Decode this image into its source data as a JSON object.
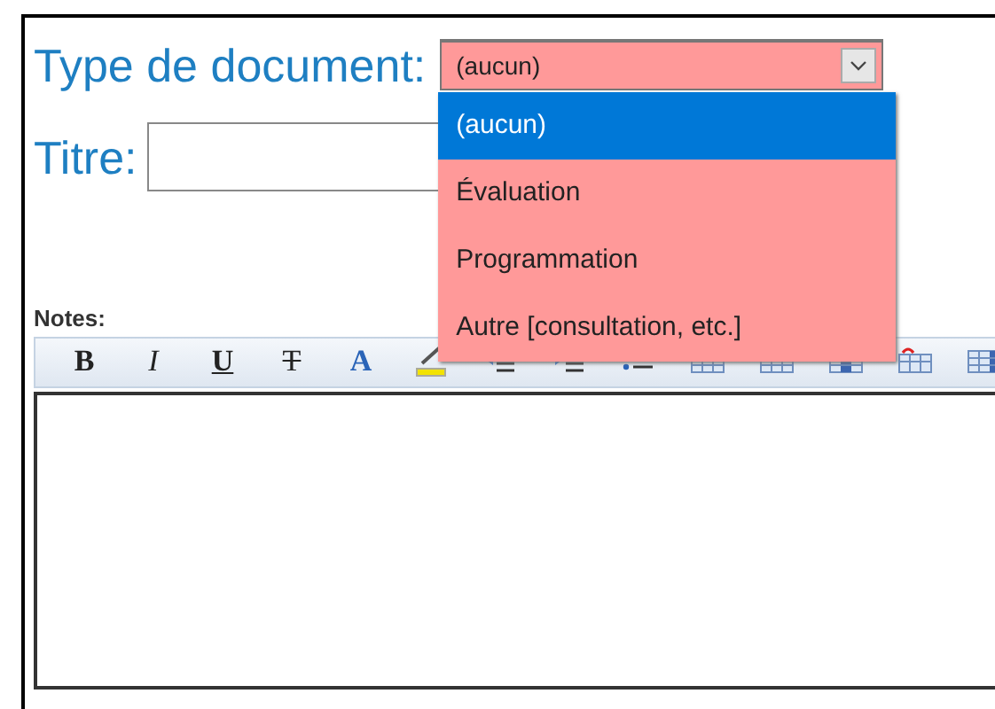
{
  "form": {
    "type_label": "Type de document:",
    "type_select": {
      "value": "(aucun)",
      "expanded": true,
      "options": [
        {
          "label": "(aucun)",
          "selected": true
        },
        {
          "label": "Évaluation",
          "selected": false
        },
        {
          "label": "Programmation",
          "selected": false
        },
        {
          "label": "Autre [consultation, etc.]",
          "selected": false
        }
      ]
    },
    "title_label": "Titre:",
    "notes_label": "Notes:"
  },
  "toolbar": {
    "letter_buttons": [
      {
        "label": "B",
        "kind": "bold"
      },
      {
        "label": "I",
        "kind": "italic"
      },
      {
        "label": "U",
        "kind": "underline"
      },
      {
        "label": "T",
        "kind": "strike"
      },
      {
        "label": "A",
        "kind": "color"
      }
    ]
  }
}
